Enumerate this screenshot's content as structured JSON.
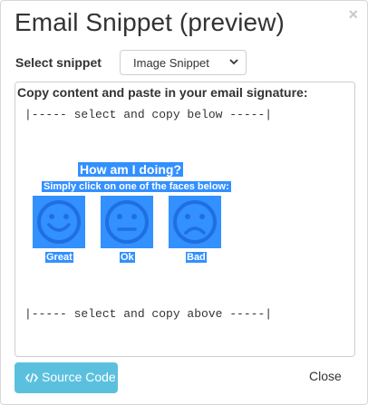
{
  "modal": {
    "title": "Email Snippet (preview)",
    "close_glyph": "×"
  },
  "snippet_select": {
    "label": "Select snippet",
    "selected": "Image Snippet"
  },
  "panel": {
    "heading": "Copy content and paste in your email signature:",
    "top_marker": "|----- select and copy below -----|",
    "bottom_marker": "|----- select and copy above -----|"
  },
  "feedback": {
    "title": "How am I doing?",
    "subtitle": "Simply click on one of the faces below:",
    "faces": [
      {
        "label": "Great",
        "icon": "happy-face-icon"
      },
      {
        "label": "Ok",
        "icon": "neutral-face-icon"
      },
      {
        "label": "Bad",
        "icon": "sad-face-icon"
      }
    ]
  },
  "footer": {
    "source_button_label": "Source Code",
    "source_icon": "code-icon",
    "close_label": "Close"
  },
  "colors": {
    "selection": "#3390ff",
    "info_button": "#5bc0de",
    "face_stroke": "#1f6fe0"
  }
}
